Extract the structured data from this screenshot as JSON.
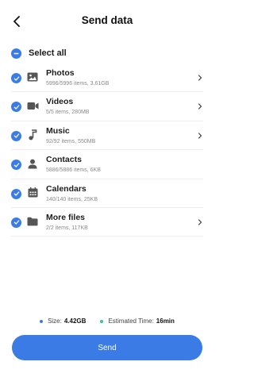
{
  "header": {
    "title": "Send data",
    "back_icon": "chevron-left-icon"
  },
  "select_all": {
    "label": "Select all",
    "state": "partial"
  },
  "categories": [
    {
      "name": "Photos",
      "meta": "5996/5996 items, 3.61GB",
      "icon": "image-icon",
      "checked": true,
      "has_chevron": true
    },
    {
      "name": "Videos",
      "meta": "5/5 items, 280MB",
      "icon": "video-camera-icon",
      "checked": true,
      "has_chevron": true
    },
    {
      "name": "Music",
      "meta": "92/92 items, 550MB",
      "icon": "music-note-icon",
      "checked": true,
      "has_chevron": true
    },
    {
      "name": "Contacts",
      "meta": "5886/5886 items, 6KB",
      "icon": "person-icon",
      "checked": true,
      "has_chevron": false
    },
    {
      "name": "Calendars",
      "meta": "140/140 items, 25KB",
      "icon": "calendar-icon",
      "checked": true,
      "has_chevron": false
    },
    {
      "name": "More files",
      "meta": "2/2 items, 117KB",
      "icon": "folder-icon",
      "checked": true,
      "has_chevron": true
    }
  ],
  "summary": {
    "size_label": "Size:",
    "size_value": "4.42GB",
    "time_label": "Estimated Time:",
    "time_value": "16min",
    "size_dot_color": "#3a7be6",
    "time_dot_color": "#36c98a"
  },
  "send_button": {
    "label": "Send"
  },
  "colors": {
    "accent": "#3a7be6"
  }
}
